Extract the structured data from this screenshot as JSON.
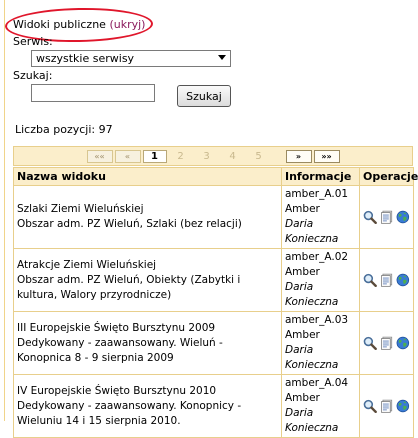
{
  "header": {
    "title": "Widoki publiczne",
    "link_open": "(",
    "link": "ukryj",
    "link_close": ")"
  },
  "filters": {
    "service_label": "Serwis:",
    "service_selected": "wszystkie serwisy",
    "search_label": "Szukaj:",
    "search_value": "",
    "search_button": "Szukaj"
  },
  "count_text": "Liczba pozycji: 97",
  "pager": {
    "first": "««",
    "prev": "«",
    "pages": [
      "1",
      "2",
      "3",
      "4",
      "5"
    ],
    "current": "1",
    "next": "»",
    "last": "»»"
  },
  "table": {
    "columns": [
      "Nazwa widoku",
      "Informacje",
      "Operacje"
    ],
    "rows": [
      {
        "name": "Szlaki Ziemi Wieluńskiej",
        "desc": "Obszar adm. PZ Wieluń, Szlaki (bez relacji)",
        "code": "amber_A.01",
        "type": "Amber",
        "author_first": "Daria",
        "author_last": "Konieczna"
      },
      {
        "name": "Atrakcje Ziemi Wieluńskiej",
        "desc": "Obszar adm. PZ Wieluń, Obiekty (Zabytki i kultura, Walory przyrodnicze)",
        "code": "amber_A.02",
        "type": "Amber",
        "author_first": "Daria",
        "author_last": "Konieczna"
      },
      {
        "name": "III Europejskie Święto Bursztynu 2009",
        "desc": "Dedykowany - zaawansowany. Wieluń - Konopnica 8 - 9 sierpnia 2009",
        "code": "amber_A.03",
        "type": "Amber",
        "author_first": "Daria",
        "author_last": "Konieczna"
      },
      {
        "name": "IV Europejskie Święto Bursztynu 2010",
        "desc": "Dedykowany - zaawansowany. Konopnicy - Wieluniu 14 i 15 sierpnia 2010.",
        "code": "amber_A.04",
        "type": "Amber",
        "author_first": "Daria",
        "author_last": "Konieczna"
      }
    ]
  },
  "icons": [
    "magnifier-icon",
    "document-icon",
    "globe-icon"
  ],
  "colors": {
    "highlight": "#e0162b",
    "header_bg": "#fbeecb",
    "border": "#e8cf8c",
    "link": "#8a1a5c"
  }
}
